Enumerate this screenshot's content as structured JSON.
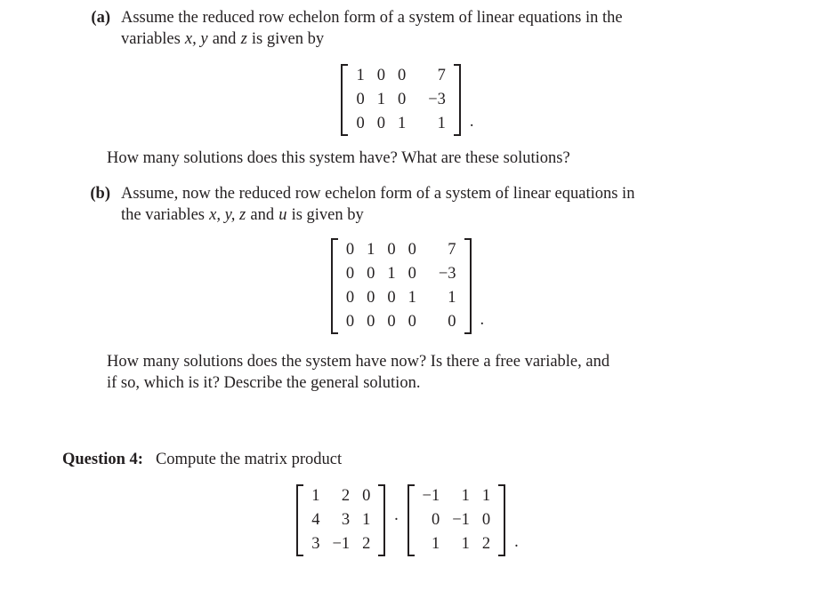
{
  "document": {
    "type": "math-exercise-sheet",
    "text_color": "#231f20",
    "background": "#ffffff"
  },
  "items": [
    {
      "label": "(a)",
      "line1_pre": "Assume the reduced row echelon form of a system of linear equations in the",
      "line2_pre": "variables ",
      "line2_vars": "x, y",
      "line2_mid": " and ",
      "line2_var2": "z",
      "line2_post": " is given by"
    },
    {
      "label": "(b)",
      "line1_pre": "Assume, now the reduced row echelon form of a system of linear equations in",
      "line2_pre": "the variables ",
      "line2_vars": "x, y, z",
      "line2_mid": " and ",
      "line2_var2": "u",
      "line2_post": " is given by"
    }
  ],
  "matrix_a": {
    "rows": [
      [
        "1",
        "0",
        "0",
        "7"
      ],
      [
        "0",
        "1",
        "0",
        "−3"
      ],
      [
        "0",
        "0",
        "1",
        "1"
      ]
    ],
    "trailing": "."
  },
  "matrix_b": {
    "rows": [
      [
        "0",
        "1",
        "0",
        "0",
        "7"
      ],
      [
        "0",
        "0",
        "1",
        "0",
        "−3"
      ],
      [
        "0",
        "0",
        "0",
        "1",
        "1"
      ],
      [
        "0",
        "0",
        "0",
        "0",
        "0"
      ]
    ],
    "trailing": "."
  },
  "prompt_a": "How many solutions does this system have?  What are these solutions?",
  "prompt_b_line1": "How many solutions does the system have now?  Is there a free variable, and",
  "prompt_b_line2": "if so, which is it?  Describe the general solution.",
  "question4": {
    "label": "Question 4:",
    "text": "Compute the matrix product",
    "operator": "·",
    "trailing": ".",
    "factor1": {
      "rows": [
        [
          "1",
          "2",
          "0"
        ],
        [
          "4",
          "3",
          "1"
        ],
        [
          "3",
          "−1",
          "2"
        ]
      ]
    },
    "factor2": {
      "rows": [
        [
          "−1",
          "1",
          "1"
        ],
        [
          "0",
          "−1",
          "0"
        ],
        [
          "1",
          "1",
          "2"
        ]
      ]
    }
  }
}
